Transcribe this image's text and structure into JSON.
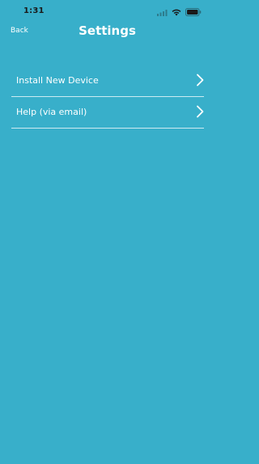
{
  "status_bar": {
    "time": "1:31",
    "icons": [
      "signal-icon",
      "wifi-icon",
      "battery-icon"
    ]
  },
  "nav": {
    "back_label": "Back",
    "title": "Settings"
  },
  "menu": {
    "items": [
      {
        "label": "Install New Device",
        "icon": "chevron-right-icon"
      },
      {
        "label": "Help (via email)",
        "icon": "chevron-right-icon"
      }
    ]
  },
  "colors": {
    "background": "#38afca",
    "text": "#ffffff",
    "status_text": "#1a1a1a"
  }
}
